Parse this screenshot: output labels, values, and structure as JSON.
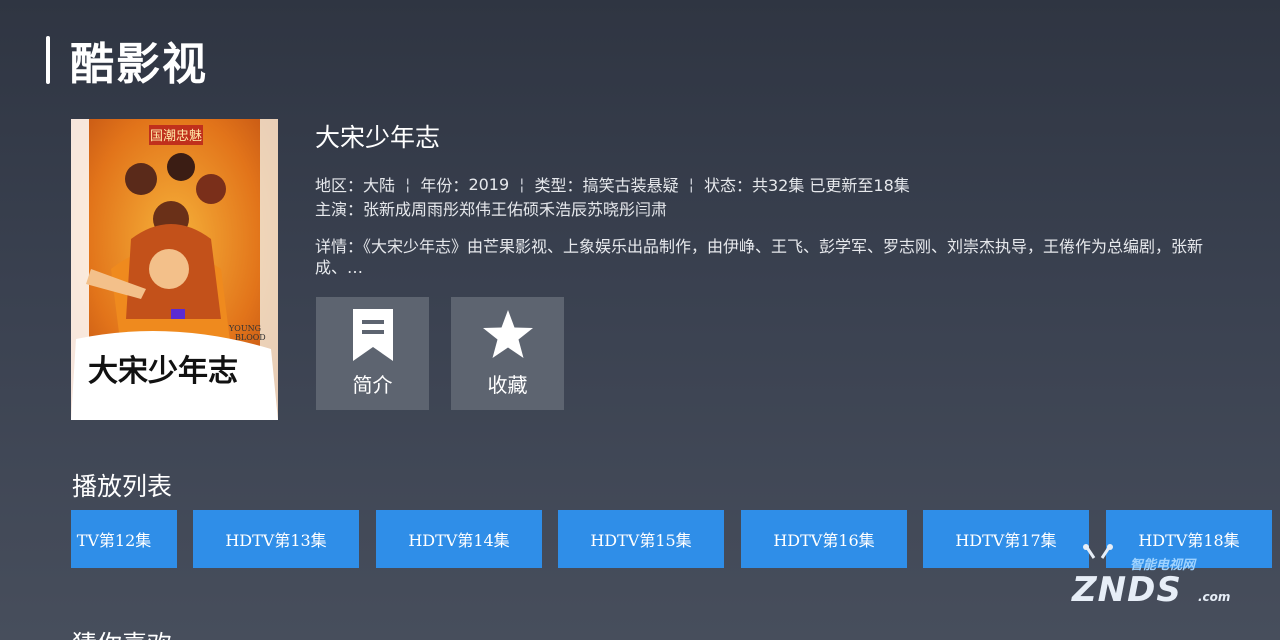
{
  "app": {
    "logo_text": "酷影视"
  },
  "show": {
    "title": "大宋少年志",
    "poster": {
      "banner_text": "国潮忠魅",
      "calligraphy": "大宋少年志",
      "english_line1": "YOUNG",
      "english_line2": "BLOOD"
    },
    "meta": [
      {
        "label": "地区：",
        "value": "大陆"
      },
      {
        "label": "年份：",
        "value": "2019"
      },
      {
        "label": "类型：",
        "value": "搞笑古装悬疑"
      },
      {
        "label": "状态：",
        "value": "共32集 已更新至18集"
      }
    ],
    "separator": "¦",
    "cast_label": "主演：",
    "cast": "张新成周雨彤郑伟王佑硕禾浩辰苏晓彤闫肃",
    "detail_label": "详情：",
    "detail": "《大宋少年志》由芒果影视、上象娱乐出品制作，由伊峥、王飞、彭学军、罗志刚、刘崇杰执导，王倦作为总编剧，张新成、…"
  },
  "actions": {
    "intro_label": "简介",
    "favorite_label": "收藏"
  },
  "playlist": {
    "title": "播放列表",
    "episodes": [
      "TV第12集",
      "HDTV第13集",
      "HDTV第14集",
      "HDTV第15集",
      "HDTV第16集",
      "HDTV第17集",
      "HDTV第18集"
    ]
  },
  "recommend": {
    "title": "猜你喜欢"
  },
  "watermark": {
    "tag": "智能电视网",
    "brand": "ZNDS",
    "domain": ".com"
  },
  "colors": {
    "episode_bg": "#2f8ee8",
    "action_bg": "#5d6470",
    "background_top": "#2f3542",
    "background_bottom": "#474e5c"
  }
}
